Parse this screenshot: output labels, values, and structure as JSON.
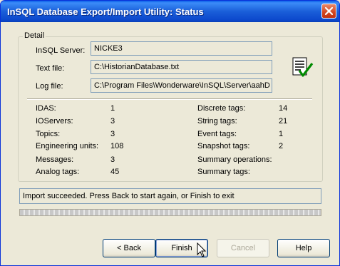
{
  "window": {
    "title": "InSQL Database Export/Import Utility: Status"
  },
  "detail": {
    "group_label": "Detail",
    "fields": [
      {
        "label": "InSQL Server:",
        "value": "NICKE3"
      },
      {
        "label": "Text file:",
        "value": "C:\\HistorianDatabase.txt"
      },
      {
        "label": "Log file:",
        "value": "C:\\Program Files\\Wonderware\\InSQL\\Server\\aahD"
      }
    ],
    "left_stats": [
      {
        "label": "IDAS:",
        "value": "1"
      },
      {
        "label": "IOServers:",
        "value": "3"
      },
      {
        "label": "Topics:",
        "value": "3"
      },
      {
        "label": "Engineering units:",
        "value": "108"
      },
      {
        "label": "Messages:",
        "value": "3"
      },
      {
        "label": "Analog tags:",
        "value": "45"
      }
    ],
    "right_stats": [
      {
        "label": "Discrete tags:",
        "value": "14"
      },
      {
        "label": "String tags:",
        "value": "21"
      },
      {
        "label": "Event tags:",
        "value": "1"
      },
      {
        "label": "Snapshot tags:",
        "value": "2"
      },
      {
        "label": "Summary operations:",
        "value": ""
      },
      {
        "label": "Summary tags:",
        "value": ""
      }
    ]
  },
  "status": {
    "message": "Import succeeded. Press Back to start again, or Finish to exit"
  },
  "buttons": {
    "back": "< Back",
    "finish": "Finish",
    "cancel": "Cancel",
    "help": "Help"
  },
  "icons": {
    "close": "close-icon",
    "status": "document-checkmark-icon",
    "cursor": "mouse-pointer-icon"
  }
}
